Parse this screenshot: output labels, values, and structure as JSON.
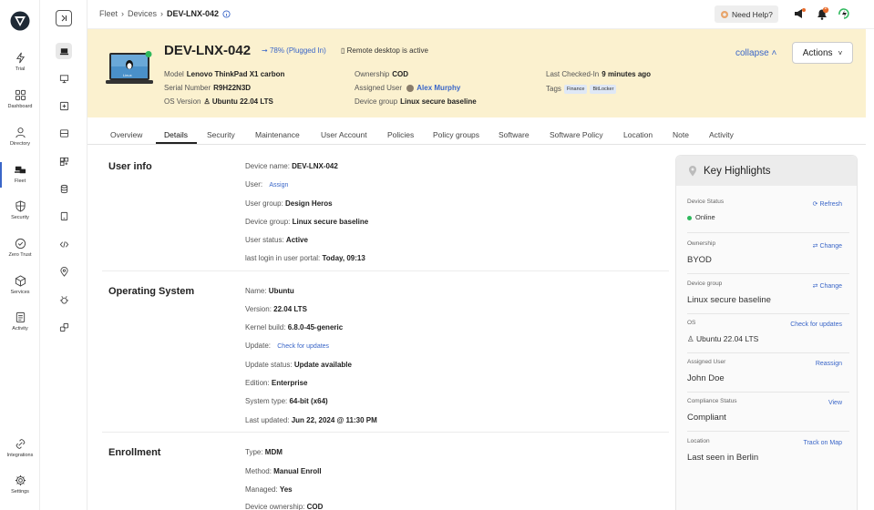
{
  "nav": {
    "items": [
      {
        "label": "Trial",
        "icon": "lightning-icon"
      },
      {
        "label": "Dashboard",
        "icon": "grid-icon"
      },
      {
        "label": "Directory",
        "icon": "user-icon"
      },
      {
        "label": "Fleet",
        "icon": "fleet-icon"
      },
      {
        "label": "Security",
        "icon": "shield-icon"
      },
      {
        "label": "Zero Trust",
        "icon": "check-shield-icon"
      },
      {
        "label": "Services",
        "icon": "cube-icon"
      },
      {
        "label": "Activity",
        "icon": "document-icon"
      },
      {
        "label": "Integrations",
        "icon": "link-icon"
      },
      {
        "label": "Settings",
        "icon": "gear-icon"
      }
    ]
  },
  "breadcrumb": {
    "items": [
      "Fleet",
      "Devices"
    ],
    "current": "DEV-LNX-042"
  },
  "topbar": {
    "help_label": "Need Help?",
    "notification_count": "2"
  },
  "header": {
    "device_name": "DEV-LNX-042",
    "battery": "78% (Plugged In)",
    "remote_desktop": "Remote desktop is active",
    "model_label": "Model",
    "model": "Lenovo ThinkPad X1 carbon",
    "serial_label": "Serial Number",
    "serial": "R9H22N3D",
    "os_label": "OS Version",
    "os": "Ubuntu 22.04 LTS",
    "ownership_label": "Ownership",
    "ownership": "COD",
    "assigned_label": "Assigned User",
    "assigned": "Alex Murphy",
    "group_label": "Device group",
    "group": "Linux secure baseline",
    "checked_label": "Last Checked-In",
    "checked": "9 minutes ago",
    "tags_label": "Tags",
    "tags": [
      "Finance",
      "BitLocker"
    ],
    "laptop_text": "Linux",
    "collapse": "collapse",
    "actions": "Actions"
  },
  "tabs": [
    "Overview",
    "Details",
    "Security",
    "Maintenance",
    "User Account",
    "Policies",
    "Policy groups",
    "Software",
    "Software Policy",
    "Location",
    "Note",
    "Activity"
  ],
  "sections": {
    "user_info": {
      "title": "User info",
      "rows": [
        {
          "k": "Device name",
          "v": "DEV-LNX-042"
        },
        {
          "k": "User",
          "v": "",
          "link": "Assign"
        },
        {
          "k": "User group",
          "v": "Design Heros"
        },
        {
          "k": "Device group",
          "v": "Linux secure baseline"
        },
        {
          "k": "User status",
          "v": "Active"
        },
        {
          "k": "last login in user portal",
          "v": "Today, 09:13"
        }
      ]
    },
    "os": {
      "title": "Operating System",
      "rows": [
        {
          "k": "Name",
          "v": "Ubuntu"
        },
        {
          "k": "Version",
          "v": "22.04 LTS"
        },
        {
          "k": "Kernel build",
          "v": "6.8.0-45-generic"
        },
        {
          "k": "Update",
          "v": "",
          "link": "Check for updates"
        },
        {
          "k": "Update status",
          "v": "Update available"
        },
        {
          "k": "Edition",
          "v": "Enterprise"
        },
        {
          "k": "System type",
          "v": "64-bit (x64)"
        },
        {
          "k": "Last updated",
          "v": "Jun 22, 2024 @ 11:30 PM"
        }
      ]
    },
    "enrollment": {
      "title": "Enrollment",
      "rows": [
        {
          "k": "Type",
          "v": "MDM"
        },
        {
          "k": "Method",
          "v": "Manual Enroll"
        },
        {
          "k": "Managed",
          "v": "Yes"
        },
        {
          "k": "Device ownership",
          "v": "COD"
        }
      ]
    }
  },
  "highlights": {
    "title": "Key Highlights",
    "items": [
      {
        "k": "Device Status",
        "v": "Online",
        "a": "Refresh"
      },
      {
        "k": "Ownership",
        "v": "BYOD",
        "a": "Change"
      },
      {
        "k": "Device group",
        "v": "Linux secure baseline",
        "a": "Change"
      },
      {
        "k": "OS",
        "v": "Ubuntu 22.04 LTS",
        "a": "Check for updates"
      },
      {
        "k": "Assigned User",
        "v": "John Doe",
        "a": "Reassign"
      },
      {
        "k": "Compliance Status",
        "v": "Compliant",
        "a": "View"
      },
      {
        "k": "Location",
        "v": "Last seen in Berlin",
        "a": "Track on Map"
      }
    ]
  },
  "colors": {
    "accent": "#3a66c8",
    "header_bg": "#fbf1cf",
    "online": "#2eb85c"
  }
}
